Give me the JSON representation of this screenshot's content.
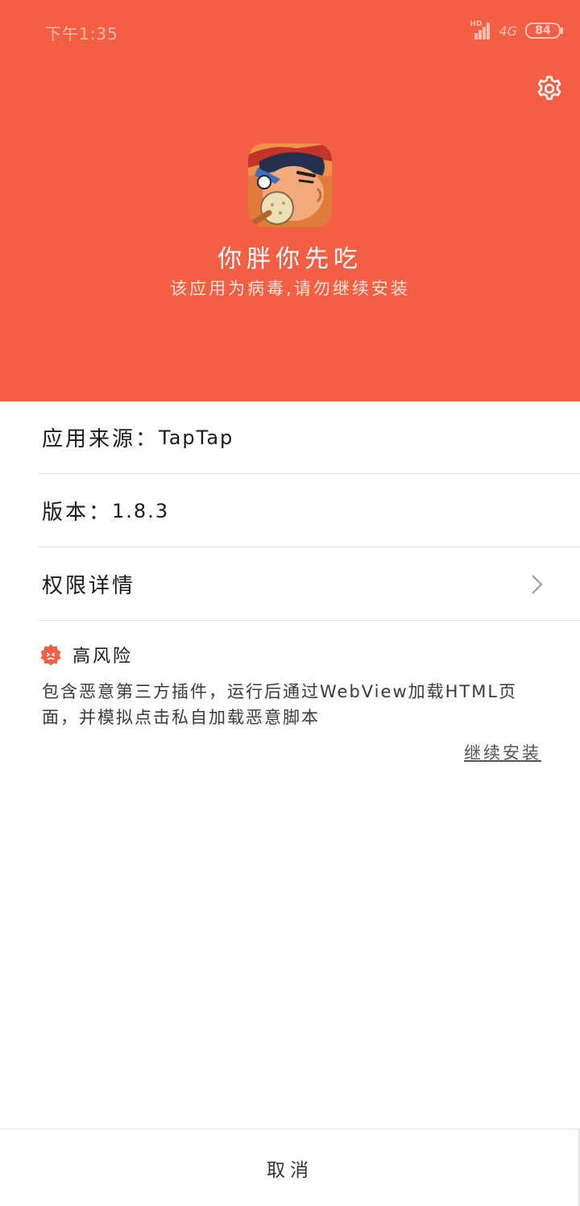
{
  "status_bar": {
    "time": "下午1:35",
    "network": "4G",
    "network_hd": "HD",
    "battery": "84"
  },
  "header": {
    "background_color": "#f35f42",
    "app_name": "你胖你先吃",
    "warning": "该应用为病毒,请勿继续安装",
    "settings_icon": "gear-icon"
  },
  "info": {
    "source_label": "应用来源：",
    "source_value": "TapTap",
    "version_label": "版本：",
    "version_value": "1.8.3",
    "permissions_label": "权限详情"
  },
  "risk": {
    "level": "高风险",
    "description": "包含恶意第三方插件，运行后通过WebView加载HTML页面，并模拟点击私自加载恶意脚本",
    "continue_label": "继续安装",
    "color": "#f35f42"
  },
  "footer": {
    "cancel_label": "取消"
  }
}
